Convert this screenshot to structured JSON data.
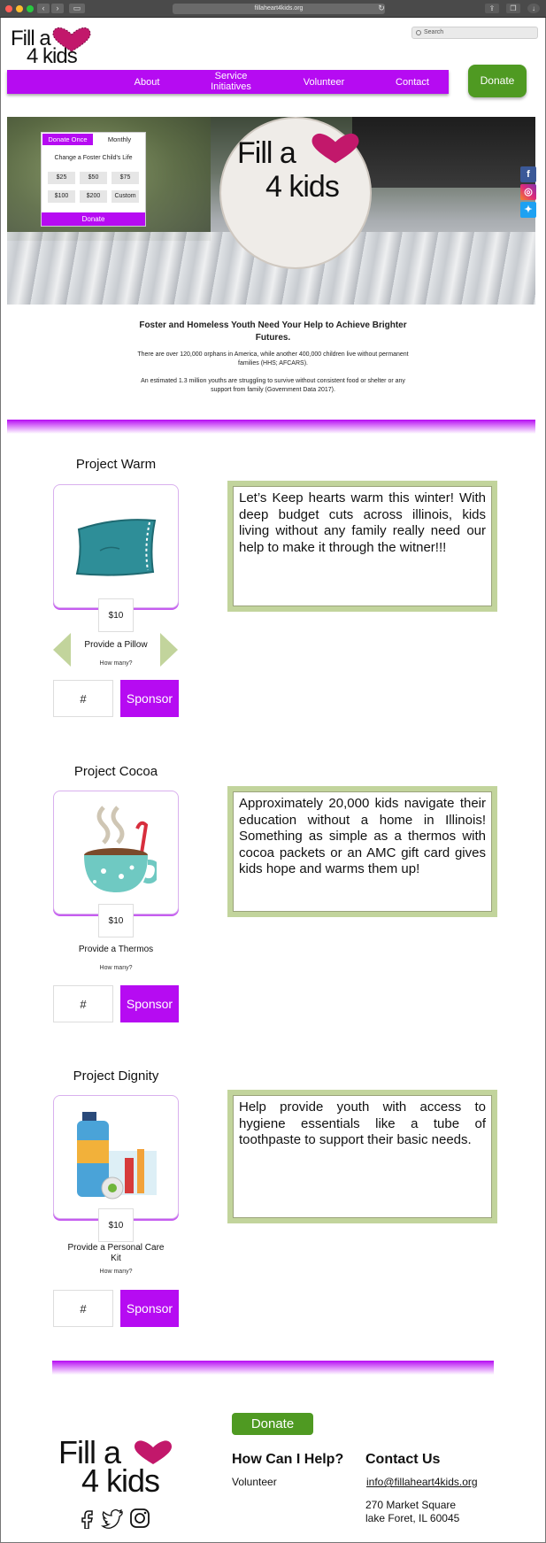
{
  "browser": {
    "url": "fillaheart4kids.org"
  },
  "header": {
    "logo_line1": "Fill a",
    "logo_line2": "4 kids",
    "search_placeholder": "Search",
    "nav": [
      "About",
      "Service Initiatives",
      "Volunteer",
      "Contact"
    ],
    "donate_label": "Donate"
  },
  "donate_widget": {
    "tab_once": "Donate Once",
    "tab_monthly": "Monthly",
    "title": "Change a Foster Child's Life",
    "amounts": [
      "$25",
      "$50",
      "$75",
      "$100",
      "$200",
      "Custom"
    ],
    "submit_label": "Donate"
  },
  "intro": {
    "title": "Foster and Homeless Youth Need Your Help to Achieve Brighter Futures.",
    "p1": "There are over 120,000 orphans in America, while another 400,000 children live without permanent families (HHS; AFCARS).",
    "p2": "An estimated 1.3 million youths are struggling to survive without consistent food or shelter or any support from family (Government Data 2017)."
  },
  "projects": [
    {
      "title": "Project Warm",
      "price": "$10",
      "item_label": "Provide a Pillow",
      "how_many": "How many?",
      "qty_placeholder": "#",
      "sponsor_label": "Sponsor",
      "description": "Let’s Keep hearts warm this winter!  With deep budget cuts across illinois, kids living without any family really need our help to make it through the witner!!!"
    },
    {
      "title": "Project Cocoa",
      "price": "$10",
      "item_label": "Provide a Thermos",
      "how_many": "How many?",
      "qty_placeholder": "#",
      "sponsor_label": "Sponsor",
      "description": "Approximately 20,000 kids navigate their education without a home in Illinois! Something as simple as a thermos with cocoa packets or an AMC gift card gives kids hope and warms them up!"
    },
    {
      "title": "Project Dignity",
      "price": "$10",
      "item_label": "Provide a Personal Care Kit",
      "how_many": "How many?",
      "qty_placeholder": "#",
      "sponsor_label": "Sponsor",
      "description": "Help provide youth with access to hygiene essentials like a tube of toothpaste to support their basic needs."
    }
  ],
  "footer": {
    "donate_label": "Donate",
    "help_heading": "How Can I Help?",
    "help_link": "Volunteer",
    "contact_heading": "Contact Us",
    "email": "info@fillaheart4kids.org",
    "address_line1": "270 Market Square",
    "address_line2": "lake Foret, IL 60045"
  },
  "colors": {
    "brand_purple": "#b60bf2",
    "donate_green": "#4f9a22",
    "box_green": "#c2d49c",
    "heart_pink": "#c2186b"
  },
  "icons": [
    "facebook-icon",
    "instagram-icon",
    "twitter-icon",
    "search-icon",
    "pillow-icon",
    "cocoa-mug-icon",
    "hygiene-kit-icon"
  ]
}
